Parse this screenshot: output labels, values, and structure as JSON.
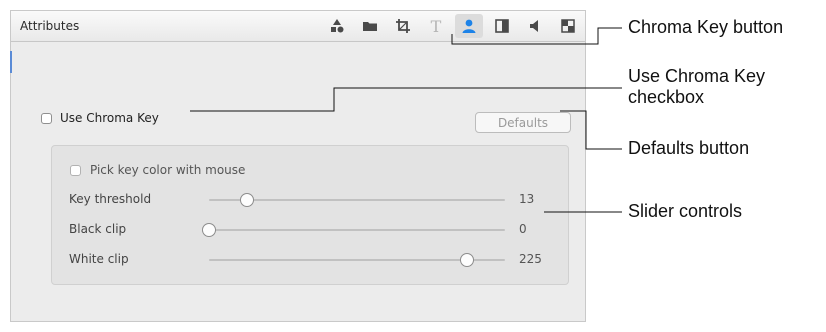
{
  "panel": {
    "title": "Attributes",
    "tabs": [
      {
        "icon": "shapes-icon",
        "glyph": "▲●",
        "active": false
      },
      {
        "icon": "folder-icon",
        "glyph": "▬",
        "active": false
      },
      {
        "icon": "crop-icon",
        "glyph": "⌗",
        "active": false
      },
      {
        "icon": "text-icon",
        "glyph": "T",
        "active": false
      },
      {
        "icon": "chroma-key-person-icon",
        "glyph": "●",
        "active": true
      },
      {
        "icon": "split-screen-icon",
        "glyph": "◧",
        "active": false
      },
      {
        "icon": "audio-speaker-icon",
        "glyph": "◀",
        "active": false
      },
      {
        "icon": "checker-icon",
        "glyph": "▣",
        "active": false
      }
    ]
  },
  "chroma": {
    "use_label": "Use Chroma Key",
    "use_checked": false,
    "defaults_label": "Defaults",
    "pick_label": "Pick key color with mouse",
    "pick_checked": false,
    "sliders": [
      {
        "label": "Key threshold",
        "value": "13",
        "fraction": 0.13
      },
      {
        "label": "Black clip",
        "value": "0",
        "fraction": 0.0
      },
      {
        "label": "White clip",
        "value": "225",
        "fraction": 0.87
      }
    ]
  },
  "annotations": {
    "chroma_key_button": "Chroma Key button",
    "use_chroma_key_checkbox_line1": "Use Chroma Key",
    "use_chroma_key_checkbox_line2": "checkbox",
    "defaults_button": "Defaults button",
    "slider_controls": "Slider controls"
  },
  "colors": {
    "accent": "#1d83e8",
    "panel_bg": "#ececec",
    "callout_line": "#111111"
  }
}
